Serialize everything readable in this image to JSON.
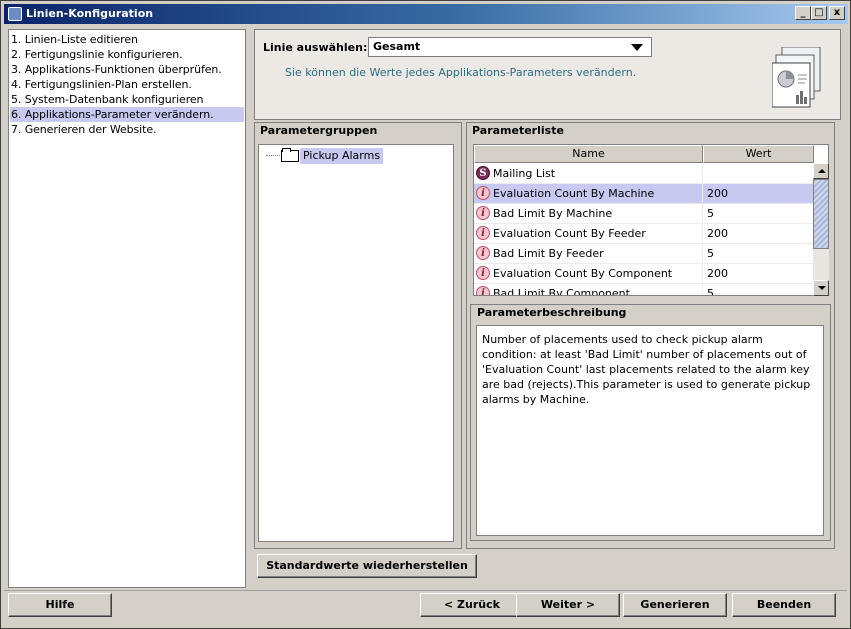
{
  "window": {
    "title": "Linien-Konfiguration",
    "controls": [
      "_",
      "□",
      "x"
    ]
  },
  "steps": [
    {
      "label": "1. Linien-Liste editieren",
      "active": false
    },
    {
      "label": "2. Fertigungslinie konfigurieren.",
      "active": false
    },
    {
      "label": "3. Applikations-Funktionen überprüfen.",
      "active": false
    },
    {
      "label": "4. Fertigungslinien-Plan erstellen.",
      "active": false
    },
    {
      "label": "5. System-Datenbank konfigurieren",
      "active": false
    },
    {
      "label": "6. Applikations-Parameter verändern.",
      "active": true
    },
    {
      "label": "7. Generieren der Website.",
      "active": false
    }
  ],
  "header": {
    "line_label": "Linie auswählen:",
    "line_value": "Gesamt",
    "hint": "Sie können die Werte jedes Applikations-Parameters verändern."
  },
  "parameter_groups": {
    "title": "Parametergruppen",
    "items": [
      {
        "label": "Pickup Alarms",
        "selected": true
      }
    ]
  },
  "parameter_list": {
    "title": "Parameterliste",
    "columns": [
      "Name",
      "Wert"
    ],
    "rows": [
      {
        "icon": "S",
        "name": "Mailing List",
        "value": "",
        "selected": false
      },
      {
        "icon": "i",
        "name": "Evaluation Count By Machine",
        "value": "200",
        "selected": true
      },
      {
        "icon": "i",
        "name": "Bad Limit By Machine",
        "value": "5",
        "selected": false
      },
      {
        "icon": "i",
        "name": "Evaluation Count By Feeder",
        "value": "200",
        "selected": false
      },
      {
        "icon": "i",
        "name": "Bad Limit By Feeder",
        "value": "5",
        "selected": false
      },
      {
        "icon": "i",
        "name": "Evaluation Count By Component",
        "value": "200",
        "selected": false
      },
      {
        "icon": "i",
        "name": "Bad Limit By Component",
        "value": "5",
        "selected": false
      }
    ]
  },
  "description": {
    "title": "Parameterbeschreibung",
    "text": "Number of placements used to check pickup alarm condition: at least 'Bad Limit' number of placements out of 'Evaluation Count' last placements related to the alarm key are bad (rejects).This parameter is used to generate pickup alarms by Machine."
  },
  "buttons": {
    "restore_defaults": "Standardwerte wiederherstellen",
    "help": "Hilfe",
    "back": "< Zurück",
    "next": "Weiter >",
    "generate": "Generieren",
    "finish": "Beenden"
  },
  "colors": {
    "selection": "#c7c9f0",
    "titlebar_start": "#0a246a",
    "hint_text": "#2c6e86",
    "info_badge": "#f4c6cf",
    "special_badge": "#7a2d55"
  }
}
